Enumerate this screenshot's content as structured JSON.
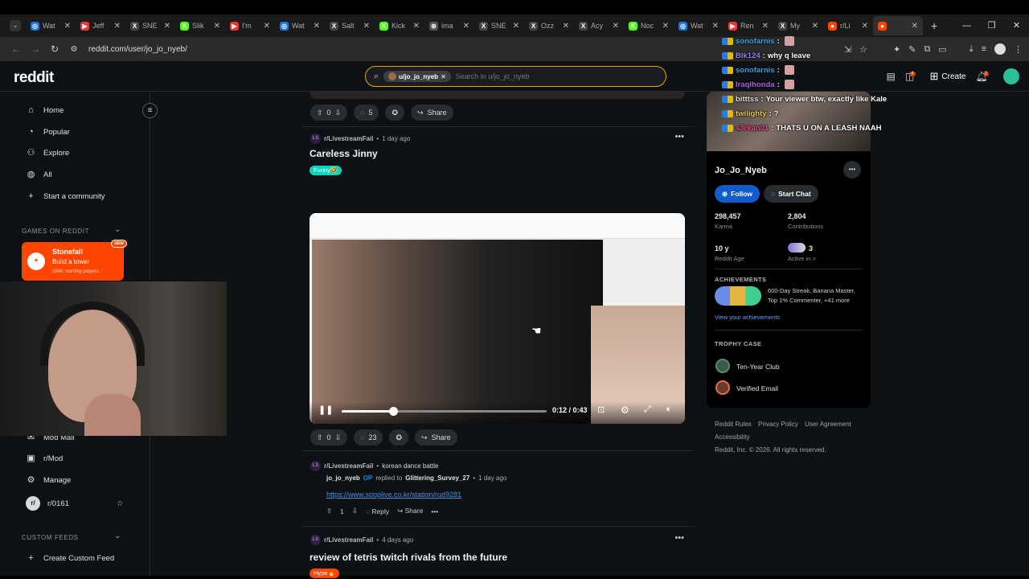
{
  "tabs": [
    {
      "title": "Wat",
      "color": "#1a73e8",
      "glyph": "◎"
    },
    {
      "title": "Jeff",
      "color": "#e53935",
      "glyph": "▶"
    },
    {
      "title": "SNE",
      "color": "#444",
      "glyph": "X"
    },
    {
      "title": "Slik",
      "color": "#53fc18",
      "glyph": "K"
    },
    {
      "title": "I'm",
      "color": "#e53935",
      "glyph": "▶"
    },
    {
      "title": "Wat",
      "color": "#1a73e8",
      "glyph": "◎"
    },
    {
      "title": "Salt",
      "color": "#444",
      "glyph": "X"
    },
    {
      "title": "Kick",
      "color": "#53fc18",
      "glyph": "K"
    },
    {
      "title": "ima",
      "color": "#555",
      "glyph": "⊕"
    },
    {
      "title": "SNE",
      "color": "#444",
      "glyph": "X"
    },
    {
      "title": "Ozz",
      "color": "#444",
      "glyph": "X"
    },
    {
      "title": "Acy",
      "color": "#444",
      "glyph": "X"
    },
    {
      "title": "Noc",
      "color": "#53fc18",
      "glyph": "K"
    },
    {
      "title": "Wat",
      "color": "#1a73e8",
      "glyph": "◎"
    },
    {
      "title": "Ren",
      "color": "#e53935",
      "glyph": "▶"
    },
    {
      "title": "My",
      "color": "#444",
      "glyph": "X"
    },
    {
      "title": "r/Li",
      "color": "#ff4500",
      "glyph": "●"
    },
    {
      "title": "",
      "color": "#ff4500",
      "glyph": "●",
      "active": true
    }
  ],
  "browser": {
    "url": "reddit.com/user/jo_jo_nyeb/",
    "new_tab": "+",
    "min": "—",
    "max": "❐",
    "close": "✕"
  },
  "reddit": {
    "logo": "reddit",
    "search_chip": "u/jo_jo_nyeb",
    "search_placeholder": "Search in u/jo_jo_nyeb",
    "create_label": "Create",
    "chat_badge": "4",
    "notif_badge": "2"
  },
  "sidebar": {
    "items": [
      {
        "label": "Home",
        "icon": "⌂"
      },
      {
        "label": "Popular",
        "icon": "◔"
      },
      {
        "label": "Explore",
        "icon": "⚇"
      },
      {
        "label": "All",
        "icon": "◍"
      },
      {
        "label": "Start a community",
        "icon": "+"
      }
    ],
    "games_header": "GAMES ON REDDIT",
    "game": {
      "name": "Stonefall",
      "tagline": "Build a tower",
      "players": "184K monthly players",
      "badge": "NEW"
    },
    "mod_items": [
      {
        "label": "Mod Mail",
        "icon": "✉"
      },
      {
        "label": "r/Mod",
        "icon": "▣"
      },
      {
        "label": "Manage",
        "icon": "⚙"
      },
      {
        "label": "r/0161",
        "icon": "r/"
      }
    ],
    "custom_header": "CUSTOM FEEDS",
    "create_feed": "Create Custom Feed"
  },
  "posts": [
    {
      "votes": "0",
      "comments": "5",
      "share": "Share"
    },
    {
      "subreddit": "r/LivestreamFail",
      "age": "1 day ago",
      "title": "Careless Jinny",
      "flair": "Funny🤣",
      "flair_color": "#0dd3bb",
      "time": "0:12 / 0:43",
      "progress": 0.25,
      "votes": "0",
      "comments": "23",
      "share": "Share"
    }
  ],
  "comment": {
    "subreddit": "r/LivestreamFail",
    "post_title": "korean dance battle",
    "author": "jo_jo_nyeb",
    "op": "OP",
    "replied": "replied to",
    "target": "Glittering_Survey_27",
    "age": "1 day ago",
    "link": "https://www.sooplive.co.kr/station/rud9281",
    "votes": "1",
    "reply": "Reply",
    "share": "Share"
  },
  "post3": {
    "subreddit": "r/LivestreamFail",
    "age": "4 days ago",
    "title": "review of tetris twitch rivals from the future",
    "flair": "Hype🔥",
    "flair_color": "#ff4500"
  },
  "profile": {
    "name": "Jo_Jo_Nyeb",
    "follow": "Follow",
    "start_chat": "Start Chat",
    "karma": "298,457",
    "karma_label": "Karma",
    "contrib": "2,804",
    "contrib_label": "Contributions",
    "age": "10 y",
    "age_label": "Reddit Age",
    "active": "3",
    "active_label": "Active in >",
    "ach_header": "ACHIEVEMENTS",
    "ach_text": "600-Day Streak, Banana Master, Top 1% Commenter, +41 more",
    "ach_link": "View your achievements",
    "trophy_header": "TROPHY CASE",
    "trophies": [
      "Ten-Year Club",
      "Verified Email"
    ]
  },
  "footer": {
    "links": [
      "Reddit Rules",
      "Privacy Policy",
      "User Agreement",
      "Accessibility"
    ],
    "copyright": "Reddit, Inc. © 2026. All rights reserved."
  },
  "chat": [
    {
      "user": "sonofarnis",
      "color": "#2ea6e8",
      "msg": ""
    },
    {
      "user": "Blk124",
      "color": "#9d7cf0",
      "msg": "why q leave"
    },
    {
      "user": "sonofarnis",
      "color": "#2ea6e8",
      "msg": ""
    },
    {
      "user": "Iraqlhonda",
      "color": "#b05be8",
      "msg": ""
    },
    {
      "user": "bitttss",
      "color": "#e0e0e0",
      "msg": "Your viewer btw, exactly like Kale"
    },
    {
      "user": "twilighty",
      "color": "#e6c84a",
      "msg": "?"
    },
    {
      "user": "s3rkan01",
      "color": "#e04a8a",
      "msg": "THATS U ON A LEASH NAAH"
    }
  ]
}
